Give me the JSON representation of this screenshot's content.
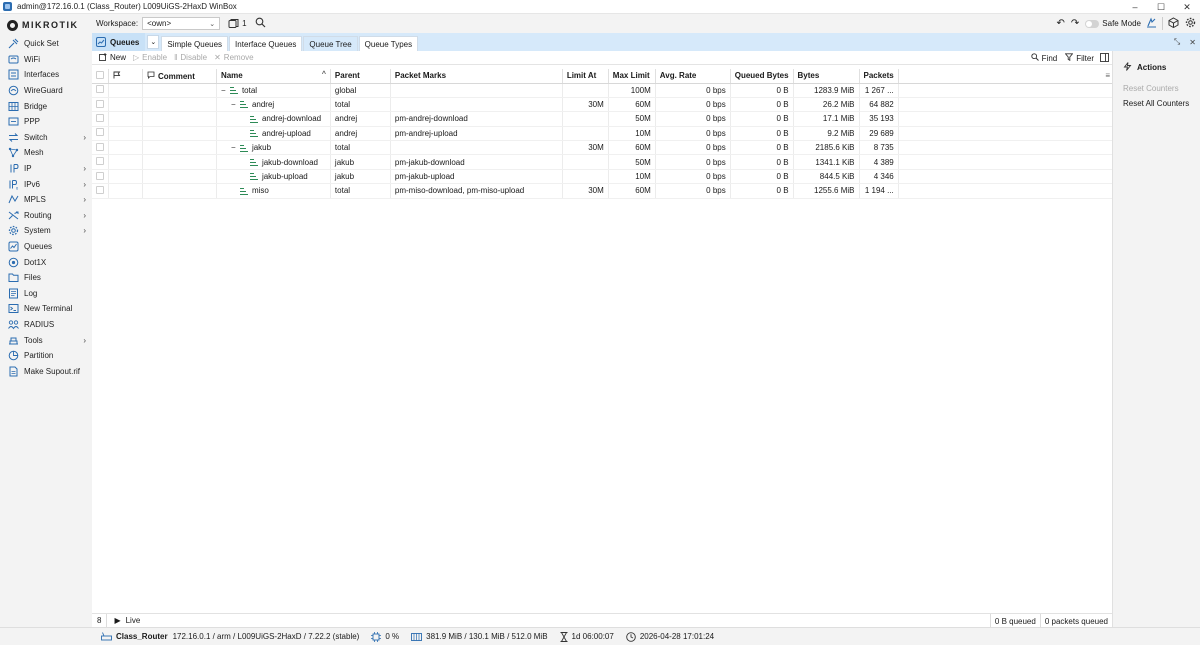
{
  "window": {
    "title": "admin@172.16.0.1 (Class_Router) L009UiGS-2HaxD WinBox",
    "controls": [
      "–",
      "☐",
      "✕"
    ]
  },
  "brand": "MIKROTIK",
  "sidebar": {
    "items": [
      {
        "label": "Quick Set",
        "icon": "quick-set-icon",
        "has_submenu": false
      },
      {
        "label": "WiFi",
        "icon": "wifi-icon",
        "has_submenu": false
      },
      {
        "label": "Interfaces",
        "icon": "interfaces-icon",
        "has_submenu": false
      },
      {
        "label": "WireGuard",
        "icon": "wireguard-icon",
        "has_submenu": false
      },
      {
        "label": "Bridge",
        "icon": "bridge-icon",
        "has_submenu": false
      },
      {
        "label": "PPP",
        "icon": "ppp-icon",
        "has_submenu": false
      },
      {
        "label": "Switch",
        "icon": "switch-icon",
        "has_submenu": true
      },
      {
        "label": "Mesh",
        "icon": "mesh-icon",
        "has_submenu": false
      },
      {
        "label": "IP",
        "icon": "ip-icon",
        "has_submenu": true
      },
      {
        "label": "IPv6",
        "icon": "ipv6-icon",
        "has_submenu": true
      },
      {
        "label": "MPLS",
        "icon": "mpls-icon",
        "has_submenu": true
      },
      {
        "label": "Routing",
        "icon": "routing-icon",
        "has_submenu": true
      },
      {
        "label": "System",
        "icon": "system-icon",
        "has_submenu": true
      },
      {
        "label": "Queues",
        "icon": "queues-icon",
        "has_submenu": false
      },
      {
        "label": "Dot1X",
        "icon": "dot1x-icon",
        "has_submenu": false
      },
      {
        "label": "Files",
        "icon": "files-icon",
        "has_submenu": false
      },
      {
        "label": "Log",
        "icon": "log-icon",
        "has_submenu": false
      },
      {
        "label": "New Terminal",
        "icon": "terminal-icon",
        "has_submenu": false
      },
      {
        "label": "RADIUS",
        "icon": "radius-icon",
        "has_submenu": false
      },
      {
        "label": "Tools",
        "icon": "tools-icon",
        "has_submenu": true
      },
      {
        "label": "Partition",
        "icon": "partition-icon",
        "has_submenu": false
      },
      {
        "label": "Make Supout.rif",
        "icon": "supout-icon",
        "has_submenu": false
      }
    ]
  },
  "topbar": {
    "workspace_label": "Workspace:",
    "workspace_value": "<own>",
    "window_count": "1",
    "safe_mode_label": "Safe Mode"
  },
  "tabs": {
    "main_label": "Queues",
    "subtabs": [
      "Simple Queues",
      "Interface Queues",
      "Queue Tree",
      "Queue Types"
    ],
    "active_subtab": "Queue Tree"
  },
  "toolbar": {
    "new_label": "New",
    "enable_label": "Enable",
    "disable_label": "Disable",
    "remove_label": "Remove",
    "find_label": "Find",
    "filter_label": "Filter"
  },
  "table": {
    "columns": [
      "Comment",
      "Name",
      "Parent",
      "Packet Marks",
      "Limit At",
      "Max Limit",
      "Avg. Rate",
      "Queued Bytes",
      "Bytes",
      "Packets"
    ],
    "rows": [
      {
        "level": 0,
        "toggle": "−",
        "name": "total",
        "parent": "global",
        "packet_marks": "",
        "limit_at": "",
        "max_limit": "100M",
        "avg_rate": "0 bps",
        "queued_bytes": "0 B",
        "bytes": "1283.9 MiB",
        "packets": "1 267 ..."
      },
      {
        "level": 1,
        "toggle": "−",
        "name": "andrej",
        "parent": "total",
        "packet_marks": "",
        "limit_at": "30M",
        "max_limit": "60M",
        "avg_rate": "0 bps",
        "queued_bytes": "0 B",
        "bytes": "26.2 MiB",
        "packets": "64 882"
      },
      {
        "level": 2,
        "toggle": "",
        "name": "andrej-download",
        "parent": "andrej",
        "packet_marks": "pm-andrej-download",
        "limit_at": "",
        "max_limit": "50M",
        "avg_rate": "0 bps",
        "queued_bytes": "0 B",
        "bytes": "17.1 MiB",
        "packets": "35 193"
      },
      {
        "level": 2,
        "toggle": "",
        "name": "andrej-upload",
        "parent": "andrej",
        "packet_marks": "pm-andrej-upload",
        "limit_at": "",
        "max_limit": "10M",
        "avg_rate": "0 bps",
        "queued_bytes": "0 B",
        "bytes": "9.2 MiB",
        "packets": "29 689"
      },
      {
        "level": 1,
        "toggle": "−",
        "name": "jakub",
        "parent": "total",
        "packet_marks": "",
        "limit_at": "30M",
        "max_limit": "60M",
        "avg_rate": "0 bps",
        "queued_bytes": "0 B",
        "bytes": "2185.6 KiB",
        "packets": "8 735"
      },
      {
        "level": 2,
        "toggle": "",
        "name": "jakub-download",
        "parent": "jakub",
        "packet_marks": "pm-jakub-download",
        "limit_at": "",
        "max_limit": "50M",
        "avg_rate": "0 bps",
        "queued_bytes": "0 B",
        "bytes": "1341.1 KiB",
        "packets": "4 389"
      },
      {
        "level": 2,
        "toggle": "",
        "name": "jakub-upload",
        "parent": "jakub",
        "packet_marks": "pm-jakub-upload",
        "limit_at": "",
        "max_limit": "10M",
        "avg_rate": "0 bps",
        "queued_bytes": "0 B",
        "bytes": "844.5 KiB",
        "packets": "4 346"
      },
      {
        "level": 1,
        "toggle": "",
        "name": "miso",
        "parent": "total",
        "packet_marks": "pm-miso-download, pm-miso-upload",
        "limit_at": "30M",
        "max_limit": "60M",
        "avg_rate": "0 bps",
        "queued_bytes": "0 B",
        "bytes": "1255.6 MiB",
        "packets": "1 194 ..."
      }
    ]
  },
  "status": {
    "count": "8",
    "live_label": "Live",
    "queued_bytes": "0 B  queued",
    "queued_packets": "0  packets queued"
  },
  "actions": {
    "title": "Actions",
    "items": [
      {
        "label": "Reset Counters",
        "enabled": false
      },
      {
        "label": "Reset All Counters",
        "enabled": true
      }
    ]
  },
  "bottombar": {
    "router_name": "Class_Router",
    "router_info": "172.16.0.1 / arm / L009UiGS-2HaxD / 7.22.2 (stable)",
    "cpu": "0 %",
    "memory": "381.9 MiB / 130.1 MiB / 512.0 MiB",
    "uptime": "1d 06:00:07",
    "datetime": "2026-04-28 17:01:24"
  },
  "colors": {
    "accent": "#d6e9fa",
    "queue_icon": "#2e8b57"
  }
}
